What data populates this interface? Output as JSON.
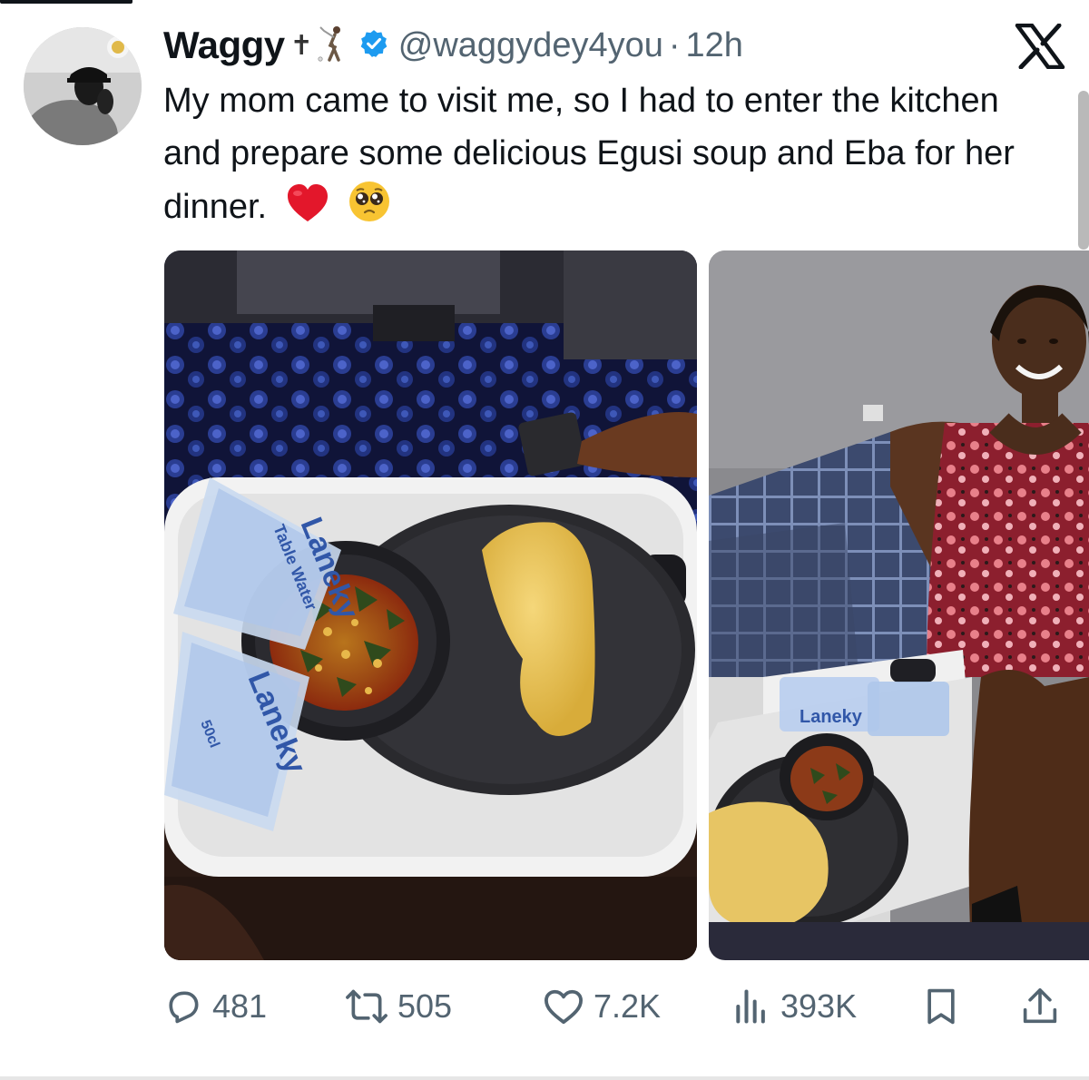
{
  "tweet": {
    "display_name": "Waggy",
    "name_emoji": "✝",
    "handle": "@waggydey4you",
    "separator": "·",
    "time": "12h",
    "text": "My mom came to visit me, so I had to enter the kitchen and prepare some delicious Egusi soup and Eba for her dinner.",
    "media": [
      {
        "description": "photo-plate-egusi-eba",
        "tray_text": [
          "Laneky",
          "Table Water",
          "50cl"
        ]
      },
      {
        "description": "photo-mom-with-tray"
      }
    ]
  },
  "actions": {
    "replies": "481",
    "reposts": "505",
    "likes": "7.2K",
    "views": "393K"
  },
  "icons": [
    "x-logo-icon",
    "verified-badge-icon",
    "golfer-icon",
    "reply-icon",
    "repost-icon",
    "like-icon",
    "views-icon",
    "bookmark-icon",
    "share-icon",
    "red-heart-emoji",
    "pleading-face-emoji"
  ],
  "colors": {
    "text": "#0f1419",
    "muted": "#536471",
    "verified": "#1d9bf0",
    "heart": "#e0245e"
  }
}
